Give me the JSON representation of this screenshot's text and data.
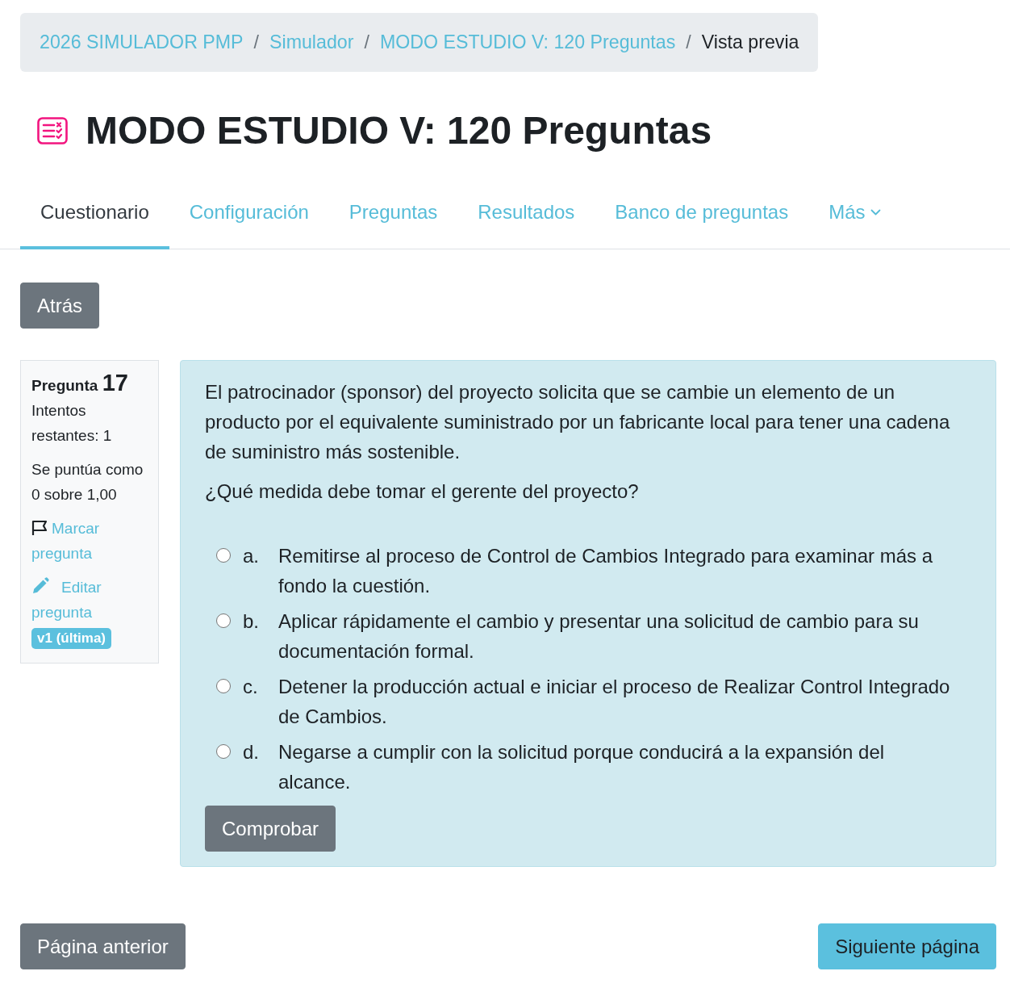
{
  "breadcrumb": {
    "separator": "/",
    "items": [
      {
        "label": "2026 SIMULADOR PMP",
        "kind": "link"
      },
      {
        "label": "Simulador",
        "kind": "link"
      },
      {
        "label": "MODO ESTUDIO V: 120 Preguntas",
        "kind": "link"
      },
      {
        "label": "Vista previa",
        "kind": "current"
      }
    ]
  },
  "page": {
    "title": "MODO ESTUDIO V: 120 Preguntas"
  },
  "tabs": [
    {
      "label": "Cuestionario",
      "selected": true,
      "dropdown": false
    },
    {
      "label": "Configuración",
      "selected": false,
      "dropdown": false
    },
    {
      "label": "Preguntas",
      "selected": false,
      "dropdown": false
    },
    {
      "label": "Resultados",
      "selected": false,
      "dropdown": false
    },
    {
      "label": "Banco de preguntas",
      "selected": false,
      "dropdown": false
    },
    {
      "label": "Más",
      "selected": false,
      "dropdown": true
    }
  ],
  "back_button": "Atrás",
  "question_info": {
    "label": "Pregunta",
    "number": "17",
    "attempts": "Intentos restantes: 1",
    "grade": "Se puntúa como 0 sobre 1,00",
    "flag_link": "Marcar pregunta",
    "edit_link": "Editar pregunta",
    "version_badge": "v1 (última)"
  },
  "question": {
    "paragraphs": [
      "El patrocinador (sponsor) del proyecto solicita que se cambie un elemento de un producto por el equivalente suministrado por un fabricante local para tener una cadena de suministro más sostenible.",
      "¿Qué medida debe tomar el gerente del proyecto?"
    ],
    "options": [
      {
        "letter": "a.",
        "text": "Remitirse al proceso de Control de Cambios Integrado para examinar más a fondo la cuestión.",
        "selected": false
      },
      {
        "letter": "b.",
        "text": "Aplicar rápidamente el cambio y presentar una solicitud de cambio para su documentación formal.",
        "selected": false
      },
      {
        "letter": "c.",
        "text": "Detener la producción actual e iniciar el proceso de Realizar Control Integrado de Cambios.",
        "selected": false
      },
      {
        "letter": "d.",
        "text": "Negarse a cumplir con la solicitud porque conducirá a la expansión del alcance.",
        "selected": false
      }
    ],
    "check_button": "Comprobar"
  },
  "navigation": {
    "previous": "Página anterior",
    "next": "Siguiente página"
  }
}
